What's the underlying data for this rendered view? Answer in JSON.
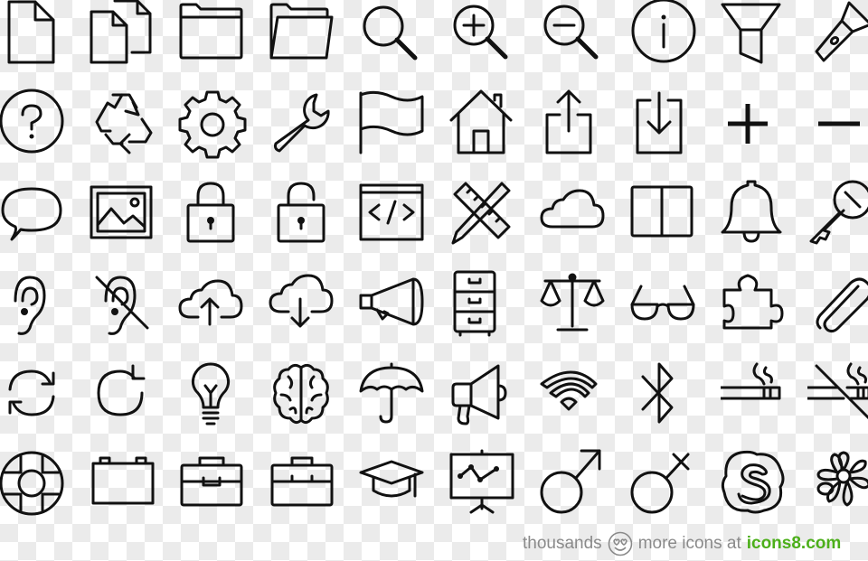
{
  "icon_grid": {
    "rows": [
      [
        "file-icon",
        "copy-icon",
        "folder-icon",
        "open-folder-icon",
        "search-icon",
        "zoom-in-icon",
        "zoom-out-icon",
        "info-icon",
        "filter-icon",
        "flashlight-icon"
      ],
      [
        "help-icon",
        "recycle-icon",
        "settings-icon",
        "wrench-icon",
        "flag-icon",
        "home-icon",
        "share-icon",
        "download-icon",
        "plus-icon",
        "minus-icon"
      ],
      [
        "speech-bubble-icon",
        "picture-icon",
        "lock-icon",
        "unlock-icon",
        "code-icon",
        "design-tools-icon",
        "cloud-icon",
        "book-icon",
        "bell-icon",
        "key-icon"
      ],
      [
        "ear-icon",
        "deaf-icon",
        "cloud-upload-icon",
        "cloud-download-icon",
        "megaphone-icon",
        "filing-cabinet-icon",
        "scales-icon",
        "glasses-icon",
        "puzzle-icon",
        "paperclip-icon"
      ],
      [
        "sync-icon",
        "refresh-icon",
        "lightbulb-icon",
        "brain-icon",
        "umbrella-icon",
        "bullhorn-icon",
        "wifi-icon",
        "bluetooth-icon",
        "smoking-icon",
        "no-smoking-icon"
      ],
      [
        "lifebuoy-icon",
        "battery-icon",
        "briefcase-icon",
        "suitcase-icon",
        "graduation-cap-icon",
        "presentation-icon",
        "male-icon",
        "transgender-icon",
        "skype-icon",
        "flower-icon"
      ]
    ]
  },
  "footer": {
    "text_before": "thousands",
    "emoji": "smiling-face-heart-eyes-icon",
    "text_after": "more icons at",
    "brand": "icons8.com",
    "brand_color": "#4caf1a",
    "text_color": "#8a8a8a"
  }
}
